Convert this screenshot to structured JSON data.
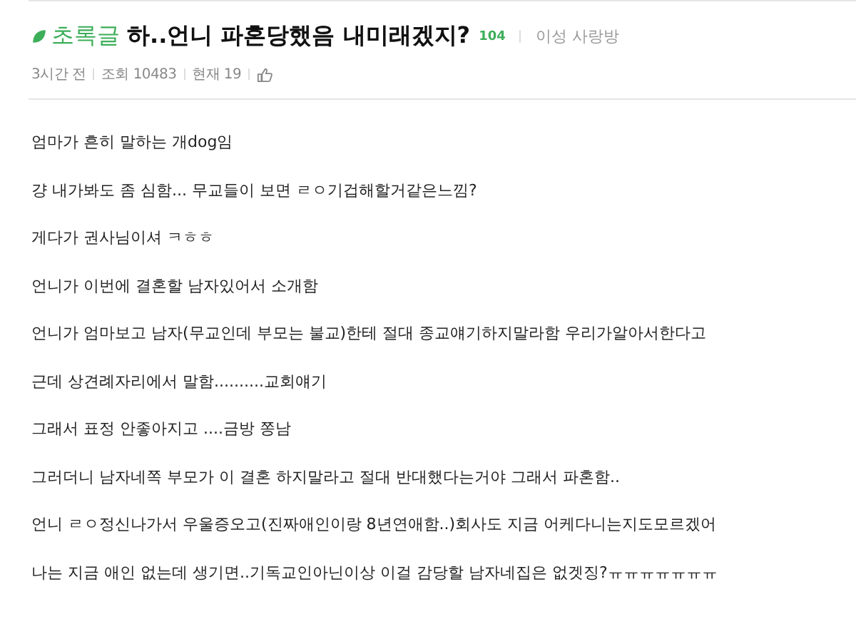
{
  "post": {
    "badge": "초록글",
    "title": "하..언니 파혼당했음 내미래겠지?",
    "comment_count": "104",
    "board": "이성 사랑방",
    "meta": [
      "3시간 전",
      "조회 10483",
      "현재 19"
    ]
  },
  "body": [
    "엄마가 흔히 말하는 개dog임",
    "걍 내가봐도 좀 심함... 무교들이 보면 ㄹㅇ기겁해할거같은느낌?",
    "게다가 권사님이셔 ㅋㅎㅎ",
    "언니가 이번에 결혼할 남자있어서 소개함",
    "언니가 엄마보고 남자(무교인데 부모는 불교)한테 절대 종교얘기하지말라함 우리가알아서한다고",
    "근데 상견례자리에서 말함..........교회얘기",
    "그래서 표정 안좋아지고 ....금방 쫑남",
    "그러더니 남자네쪽 부모가 이 결혼 하지말라고 절대 반대했다는거야 그래서 파혼함..",
    "언니 ㄹㅇ정신나가서 우울증오고(진짜애인이랑 8년연애함..)회사도 지금 어케다니는지도모르겠어",
    "나는 지금 애인 없는데 생기면..기독교인아닌이상 이걸 감당할 남자네집은 없겟징?ㅠㅠㅠㅠㅠㅠㅠ"
  ]
}
